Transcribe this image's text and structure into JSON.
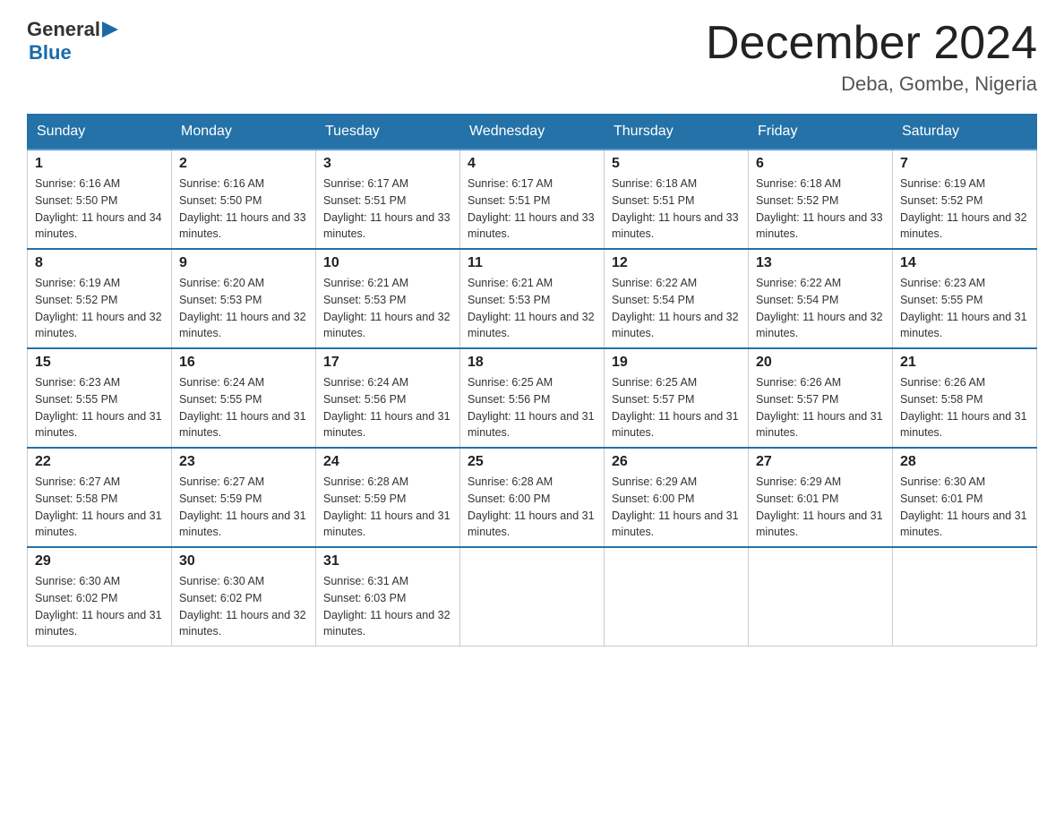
{
  "logo": {
    "text_general": "General",
    "text_blue": "Blue"
  },
  "title": "December 2024",
  "subtitle": "Deba, Gombe, Nigeria",
  "days_of_week": [
    "Sunday",
    "Monday",
    "Tuesday",
    "Wednesday",
    "Thursday",
    "Friday",
    "Saturday"
  ],
  "weeks": [
    [
      {
        "day": 1,
        "sunrise": "6:16 AM",
        "sunset": "5:50 PM",
        "daylight": "11 hours and 34 minutes."
      },
      {
        "day": 2,
        "sunrise": "6:16 AM",
        "sunset": "5:50 PM",
        "daylight": "11 hours and 33 minutes."
      },
      {
        "day": 3,
        "sunrise": "6:17 AM",
        "sunset": "5:51 PM",
        "daylight": "11 hours and 33 minutes."
      },
      {
        "day": 4,
        "sunrise": "6:17 AM",
        "sunset": "5:51 PM",
        "daylight": "11 hours and 33 minutes."
      },
      {
        "day": 5,
        "sunrise": "6:18 AM",
        "sunset": "5:51 PM",
        "daylight": "11 hours and 33 minutes."
      },
      {
        "day": 6,
        "sunrise": "6:18 AM",
        "sunset": "5:52 PM",
        "daylight": "11 hours and 33 minutes."
      },
      {
        "day": 7,
        "sunrise": "6:19 AM",
        "sunset": "5:52 PM",
        "daylight": "11 hours and 32 minutes."
      }
    ],
    [
      {
        "day": 8,
        "sunrise": "6:19 AM",
        "sunset": "5:52 PM",
        "daylight": "11 hours and 32 minutes."
      },
      {
        "day": 9,
        "sunrise": "6:20 AM",
        "sunset": "5:53 PM",
        "daylight": "11 hours and 32 minutes."
      },
      {
        "day": 10,
        "sunrise": "6:21 AM",
        "sunset": "5:53 PM",
        "daylight": "11 hours and 32 minutes."
      },
      {
        "day": 11,
        "sunrise": "6:21 AM",
        "sunset": "5:53 PM",
        "daylight": "11 hours and 32 minutes."
      },
      {
        "day": 12,
        "sunrise": "6:22 AM",
        "sunset": "5:54 PM",
        "daylight": "11 hours and 32 minutes."
      },
      {
        "day": 13,
        "sunrise": "6:22 AM",
        "sunset": "5:54 PM",
        "daylight": "11 hours and 32 minutes."
      },
      {
        "day": 14,
        "sunrise": "6:23 AM",
        "sunset": "5:55 PM",
        "daylight": "11 hours and 31 minutes."
      }
    ],
    [
      {
        "day": 15,
        "sunrise": "6:23 AM",
        "sunset": "5:55 PM",
        "daylight": "11 hours and 31 minutes."
      },
      {
        "day": 16,
        "sunrise": "6:24 AM",
        "sunset": "5:55 PM",
        "daylight": "11 hours and 31 minutes."
      },
      {
        "day": 17,
        "sunrise": "6:24 AM",
        "sunset": "5:56 PM",
        "daylight": "11 hours and 31 minutes."
      },
      {
        "day": 18,
        "sunrise": "6:25 AM",
        "sunset": "5:56 PM",
        "daylight": "11 hours and 31 minutes."
      },
      {
        "day": 19,
        "sunrise": "6:25 AM",
        "sunset": "5:57 PM",
        "daylight": "11 hours and 31 minutes."
      },
      {
        "day": 20,
        "sunrise": "6:26 AM",
        "sunset": "5:57 PM",
        "daylight": "11 hours and 31 minutes."
      },
      {
        "day": 21,
        "sunrise": "6:26 AM",
        "sunset": "5:58 PM",
        "daylight": "11 hours and 31 minutes."
      }
    ],
    [
      {
        "day": 22,
        "sunrise": "6:27 AM",
        "sunset": "5:58 PM",
        "daylight": "11 hours and 31 minutes."
      },
      {
        "day": 23,
        "sunrise": "6:27 AM",
        "sunset": "5:59 PM",
        "daylight": "11 hours and 31 minutes."
      },
      {
        "day": 24,
        "sunrise": "6:28 AM",
        "sunset": "5:59 PM",
        "daylight": "11 hours and 31 minutes."
      },
      {
        "day": 25,
        "sunrise": "6:28 AM",
        "sunset": "6:00 PM",
        "daylight": "11 hours and 31 minutes."
      },
      {
        "day": 26,
        "sunrise": "6:29 AM",
        "sunset": "6:00 PM",
        "daylight": "11 hours and 31 minutes."
      },
      {
        "day": 27,
        "sunrise": "6:29 AM",
        "sunset": "6:01 PM",
        "daylight": "11 hours and 31 minutes."
      },
      {
        "day": 28,
        "sunrise": "6:30 AM",
        "sunset": "6:01 PM",
        "daylight": "11 hours and 31 minutes."
      }
    ],
    [
      {
        "day": 29,
        "sunrise": "6:30 AM",
        "sunset": "6:02 PM",
        "daylight": "11 hours and 31 minutes."
      },
      {
        "day": 30,
        "sunrise": "6:30 AM",
        "sunset": "6:02 PM",
        "daylight": "11 hours and 32 minutes."
      },
      {
        "day": 31,
        "sunrise": "6:31 AM",
        "sunset": "6:03 PM",
        "daylight": "11 hours and 32 minutes."
      },
      null,
      null,
      null,
      null
    ]
  ]
}
